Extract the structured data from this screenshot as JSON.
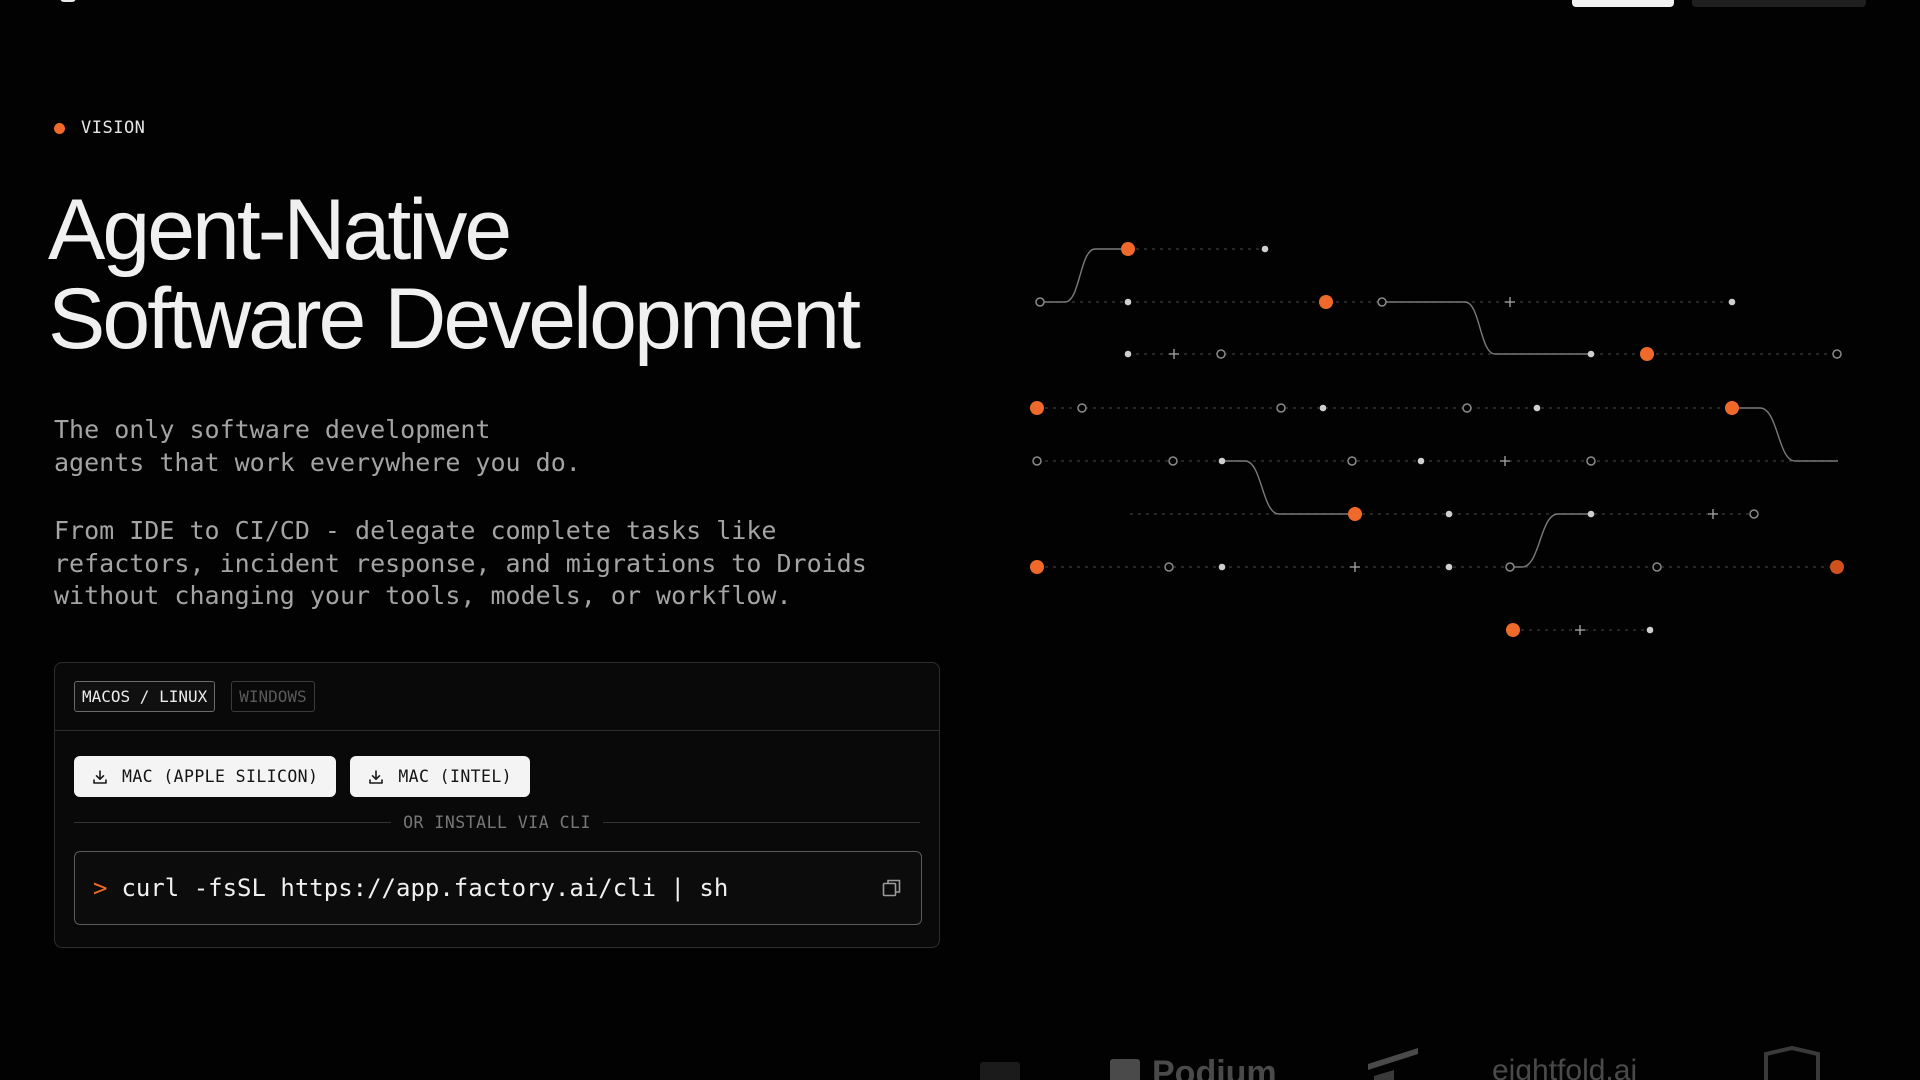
{
  "eyebrow": {
    "label": "VISION",
    "dot_color": "#ef6a2a"
  },
  "hero": {
    "title_line1": "Agent-Native",
    "title_line2": "Software Development",
    "desc1_line1": "The only software development",
    "desc1_line2": "agents that work everywhere you do.",
    "desc2_line1": "From IDE to CI/CD - delegate complete tasks like",
    "desc2_line2": "refactors, incident response, and migrations to Droids",
    "desc2_line3": "without changing your tools, models, or workflow."
  },
  "install": {
    "tabs": [
      {
        "label": "MACOS / LINUX",
        "active": true
      },
      {
        "label": "WINDOWS",
        "active": false
      }
    ],
    "downloads": [
      {
        "label": "MAC (APPLE SILICON)",
        "icon": "download-icon"
      },
      {
        "label": "MAC (INTEL)",
        "icon": "download-icon"
      }
    ],
    "divider_label": "OR INSTALL VIA CLI",
    "cli": {
      "prompt": ">",
      "command": "curl -fsSL https://app.factory.ai/cli | sh",
      "copy_icon": "copy-icon"
    }
  },
  "logos": {
    "podium": "Podium",
    "eightfold": "eightfold.ai"
  },
  "colors": {
    "accent": "#ef6a2a",
    "background": "#020202",
    "text_muted": "#a4a4a4"
  }
}
